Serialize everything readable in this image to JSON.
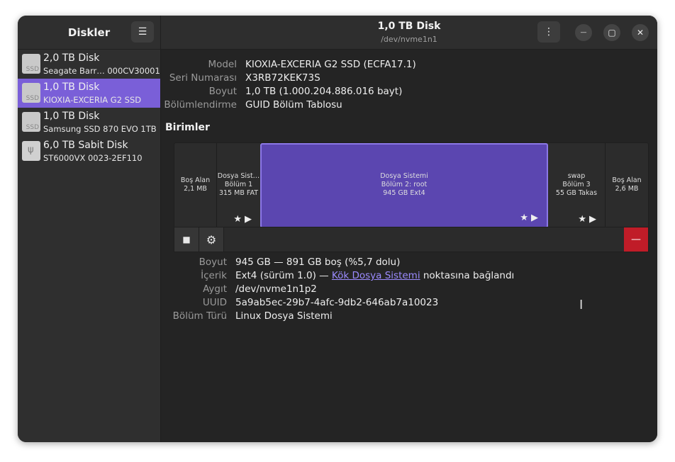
{
  "sidebar": {
    "title": "Diskler",
    "menu_icon": "hamburger-menu-icon",
    "items": [
      {
        "name": "2,0 TB Disk",
        "subtitle": "Seagate Barr… 000CV30001",
        "icon": "ssd-drive-icon",
        "icon_label": "SSD"
      },
      {
        "name": "1,0 TB Disk",
        "subtitle": "KIOXIA-EXCERIA G2 SSD",
        "icon": "ssd-drive-icon",
        "icon_label": "SSD",
        "selected": true
      },
      {
        "name": "1,0 TB Disk",
        "subtitle": "Samsung SSD 870 EVO 1TB",
        "icon": "ssd-drive-icon",
        "icon_label": "SSD"
      },
      {
        "name": "6,0 TB Sabit Disk",
        "subtitle": "ST6000VX 0023-2EF110",
        "icon": "usb-drive-icon",
        "icon_label": "ψ"
      }
    ]
  },
  "header": {
    "title": "1,0 TB Disk",
    "subtitle": "/dev/nvme1n1",
    "menu_glyph": "⋮",
    "minimize_glyph": "—",
    "maximize_glyph": "▢",
    "close_glyph": "✕"
  },
  "disk_info": {
    "model_label": "Model",
    "model_value": "KIOXIA-EXCERIA G2 SSD (ECFA17.1)",
    "serial_label": "Seri Numarası",
    "serial_value": "X3RB72KEK73S",
    "size_label": "Boyut",
    "size_value": "1,0 TB (1.000.204.886.016 bayt)",
    "partitioning_label": "Bölümlendirme",
    "partitioning_value": "GUID Bölüm Tablosu"
  },
  "volumes": {
    "title": "Birimler",
    "segments": [
      {
        "lines": [
          "Boş Alan",
          "2,1 MB"
        ],
        "selected": false
      },
      {
        "lines": [
          "Dosya Sist…",
          "Bölüm 1",
          "315 MB FAT"
        ],
        "selected": false,
        "icons": "★▶"
      },
      {
        "lines": [
          "Dosya Sistemi",
          "Bölüm 2: root",
          "945 GB Ext4"
        ],
        "selected": true,
        "icons": "★▶"
      },
      {
        "lines": [
          "swap",
          "Bölüm 3",
          "55 GB Takas"
        ],
        "selected": false,
        "icons": "★▶"
      },
      {
        "lines": [
          "Boş Alan",
          "2,6 MB"
        ],
        "selected": false
      }
    ]
  },
  "toolbar": {
    "stop_glyph": "■",
    "settings_glyph": "⚙",
    "delete_glyph": "—"
  },
  "partition_info": {
    "size_label": "Boyut",
    "size_value": "945 GB — 891 GB boş (%5,7 dolu)",
    "content_label": "İçerik",
    "content_prefix": "Ext4 (sürüm 1.0) — ",
    "content_link": "Kök Dosya Sistemi",
    "content_suffix": " noktasına bağlandı",
    "device_label": "Aygıt",
    "device_value": "/dev/nvme1n1p2",
    "uuid_label": "UUID",
    "uuid_value": "5a9ab5ec-29b7-4afc-9db2-646ab7a10023",
    "type_label": "Bölüm Türü",
    "type_value": "Linux Dosya Sistemi"
  },
  "cursor_glyph": "I"
}
